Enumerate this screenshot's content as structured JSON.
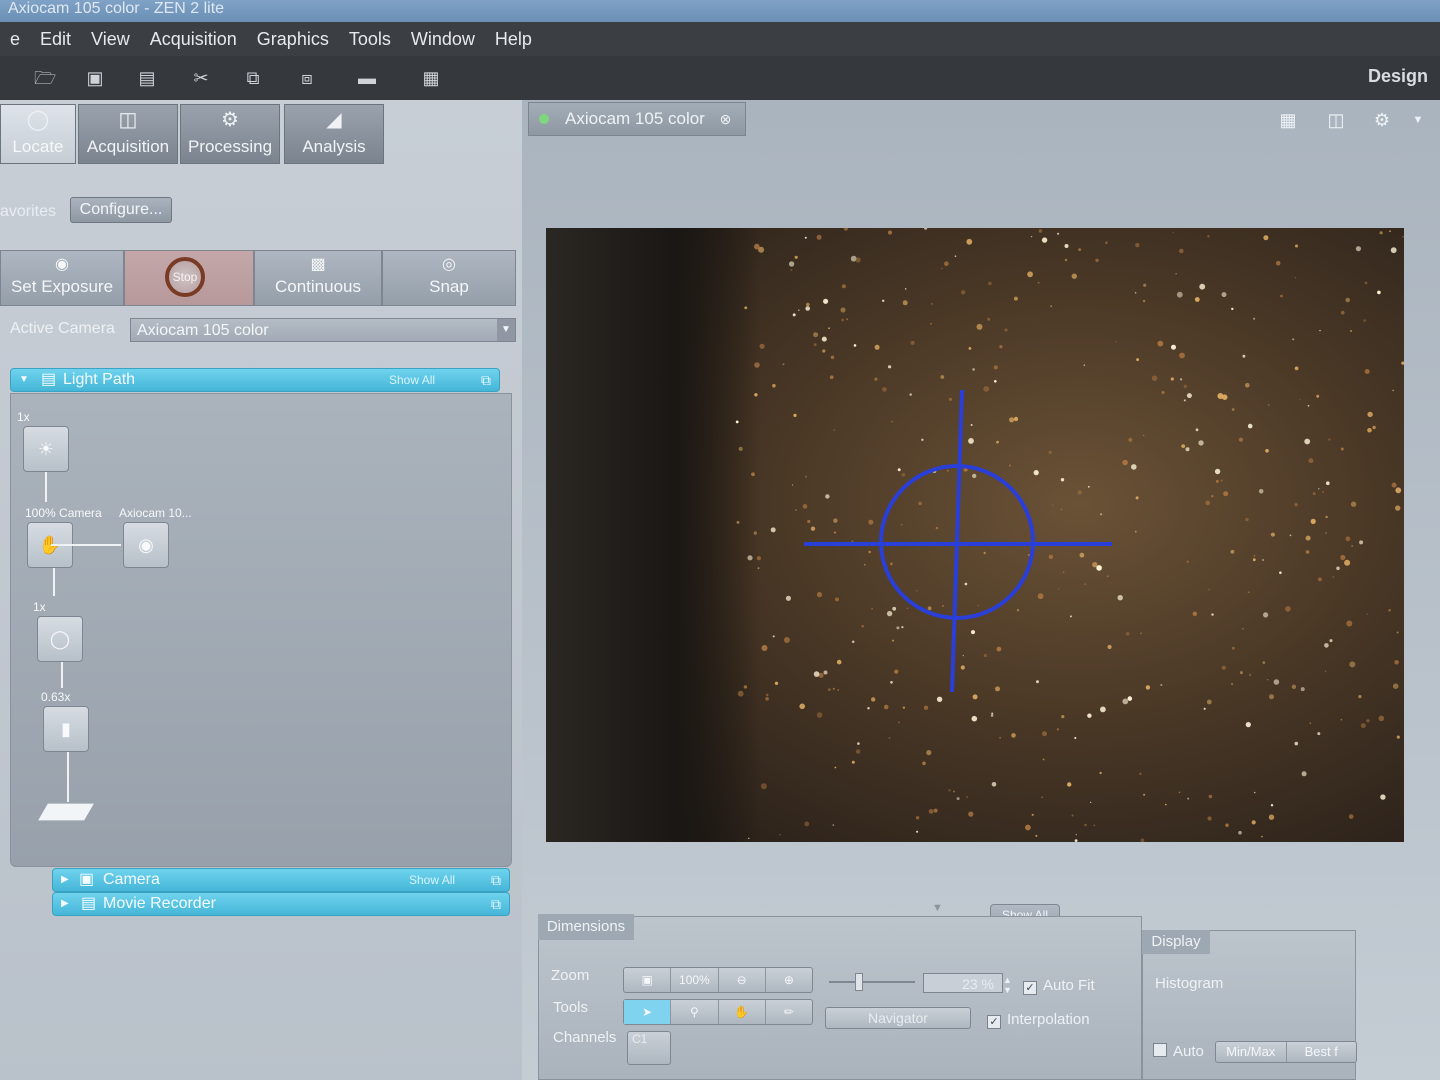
{
  "window": {
    "title": "Axiocam 105 color - ZEN 2 lite"
  },
  "menu": [
    "e",
    "Edit",
    "View",
    "Acquisition",
    "Graphics",
    "Tools",
    "Window",
    "Help"
  ],
  "toolbar": {
    "design_label": "Design"
  },
  "main_tabs": [
    {
      "label": "Locate",
      "icon": "microscope-icon"
    },
    {
      "label": "Acquisition",
      "icon": "camera-monitor-icon"
    },
    {
      "label": "Processing",
      "icon": "gears-icon"
    },
    {
      "label": "Analysis",
      "icon": "chart-icon"
    }
  ],
  "favorites": {
    "label": "avorites",
    "configure_label": "Configure..."
  },
  "acquisition_buttons": {
    "set_exposure": "Set Exposure",
    "stop": "Stop",
    "continuous": "Continuous",
    "snap": "Snap"
  },
  "active_camera": {
    "label": "Active Camera",
    "value": "Axiocam 105 color"
  },
  "light_path": {
    "title": "Light Path",
    "show_all": "Show All",
    "labels": {
      "lens_mag": "1x",
      "camera_port": "100% Camera",
      "camera_name": "Axiocam 10...",
      "optovar": "1x",
      "adapter": "0.63x"
    }
  },
  "camera_section": {
    "title": "Camera",
    "show_all": "Show All"
  },
  "movie_section": {
    "title": "Movie Recorder"
  },
  "image_tab": {
    "label": "Axiocam 105 color"
  },
  "show_all_tab": "Show All",
  "dimensions": {
    "tab": "Dimensions",
    "zoom_label": "Zoom",
    "zoom_100": "100%",
    "zoom_value": "23 %",
    "auto_fit": "Auto Fit",
    "tools_label": "Tools",
    "navigator": "Navigator",
    "interpolation": "Interpolation",
    "channels_label": "Channels",
    "channel_c1": "C1"
  },
  "display": {
    "tab": "Display",
    "histogram": "Histogram",
    "auto": "Auto",
    "minmax": "Min/Max",
    "best": "Best f"
  }
}
